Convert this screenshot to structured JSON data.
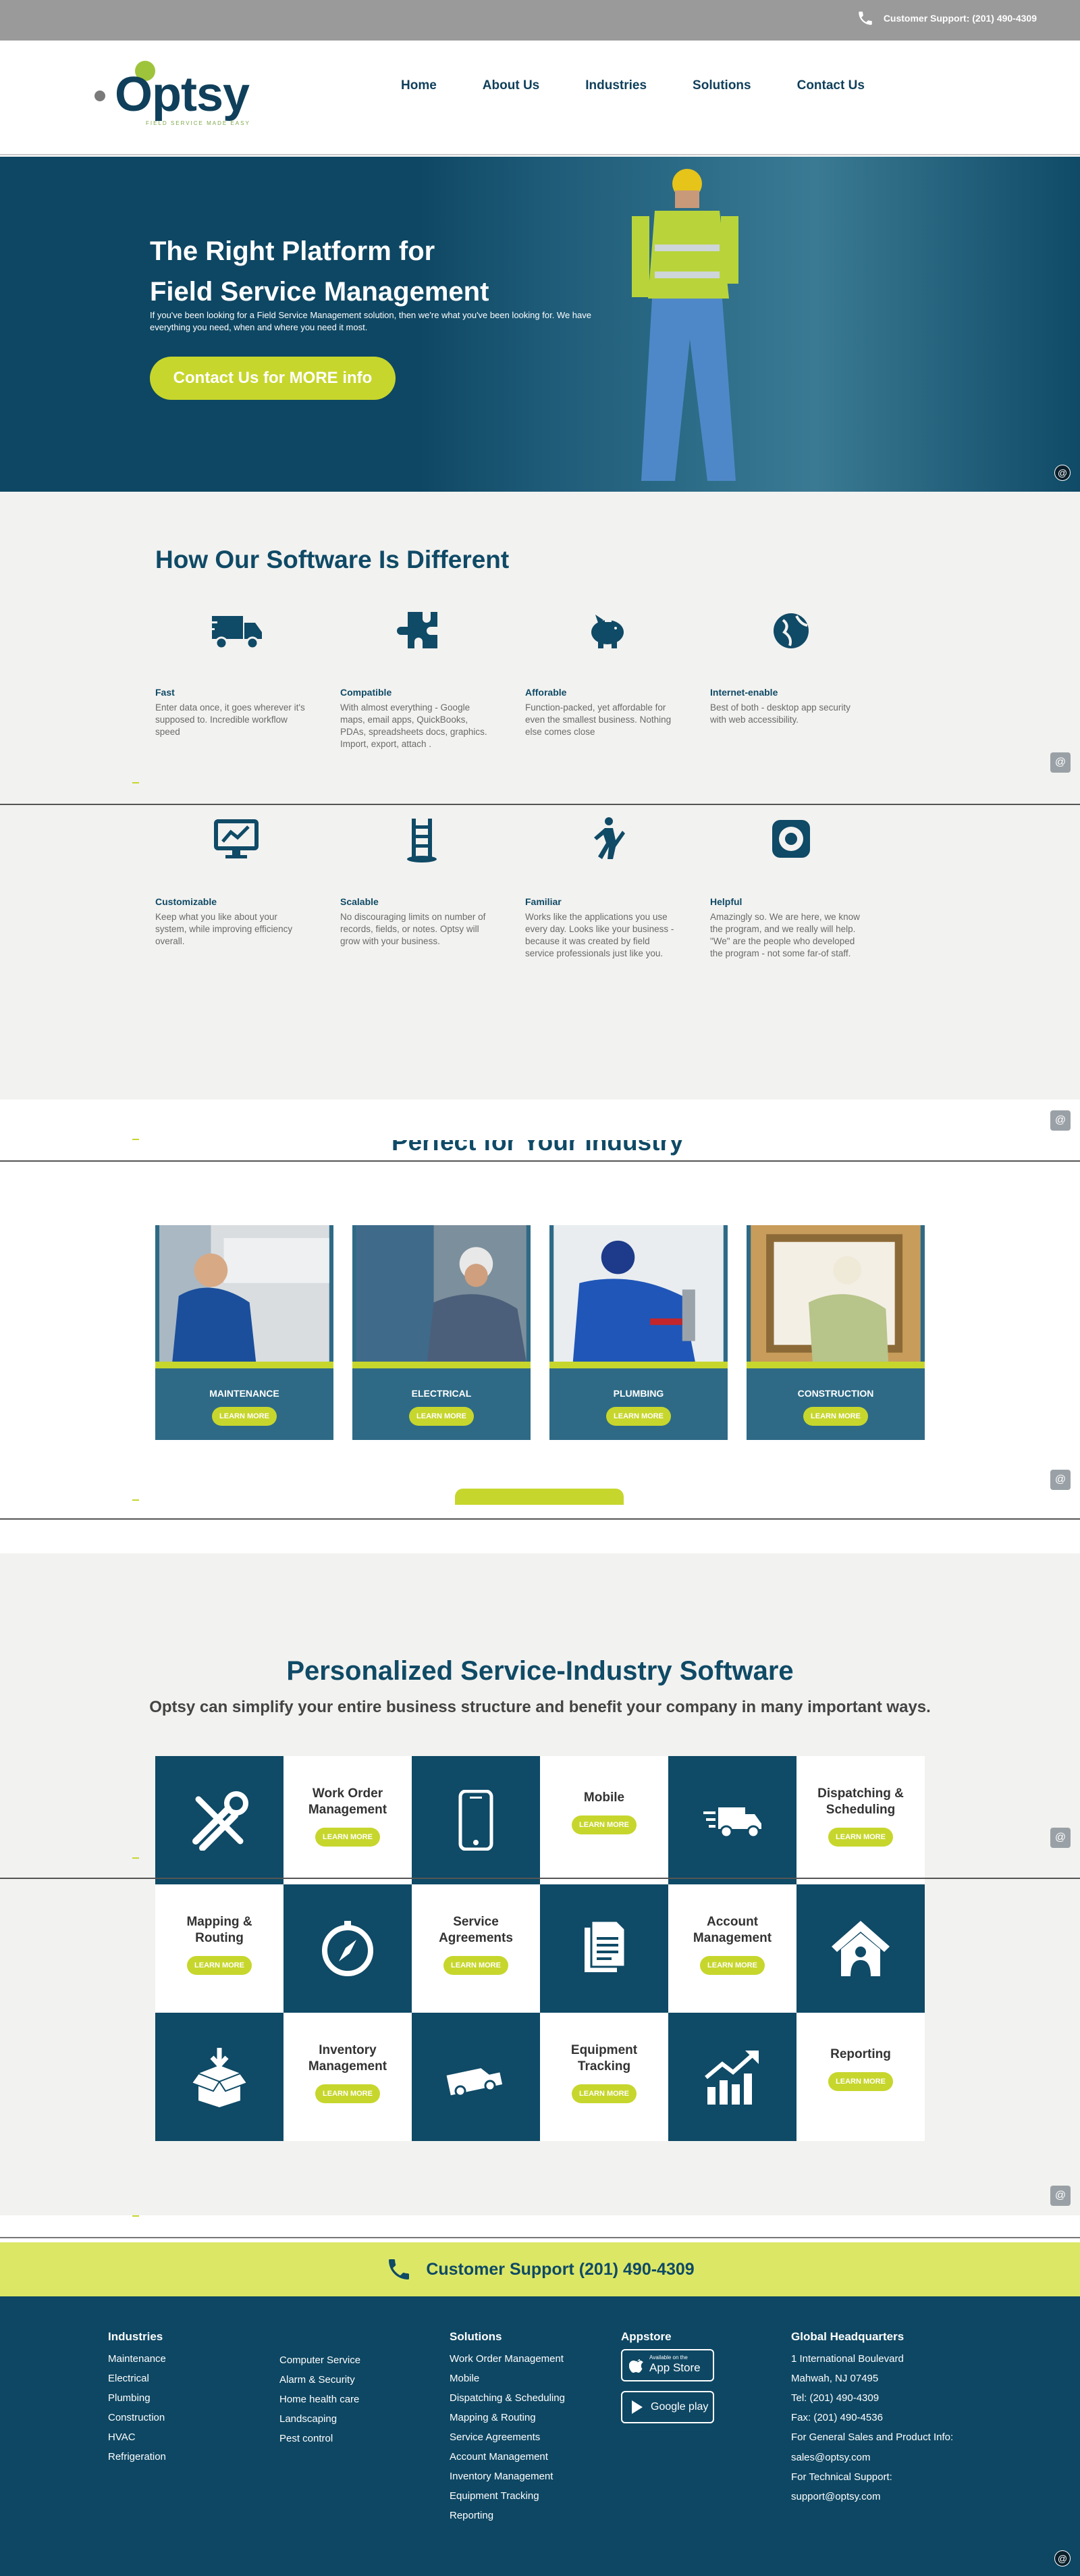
{
  "topbar": {
    "support": "Customer Support: (201) 490-4309",
    "icon": "phone-icon"
  },
  "logo": {
    "word": "Optsy",
    "tagline": "FIELD SERVICE MADE EASY"
  },
  "nav": [
    {
      "label": "Home"
    },
    {
      "label": "About Us"
    },
    {
      "label": "Industries"
    },
    {
      "label": "Solutions"
    },
    {
      "label": "Contact Us"
    }
  ],
  "hero": {
    "title_line1": "The Right Platform for",
    "title_line2": "Field Service Management",
    "text": "If you've been looking for a Field Service Management solution, then we're what you've been looking for. We have everything you need, when and where you need it most.",
    "cta": "Contact Us for MORE info",
    "widget": "@"
  },
  "diff": {
    "heading": "How Our Software Is Different",
    "features": [
      {
        "icon": "truck-icon",
        "title": "Fast",
        "text": "Enter data once, it goes wherever it's supposed to. Incredible workflow speed"
      },
      {
        "icon": "puzzle-icon",
        "title": "Compatible",
        "text": "With almost everything - Google maps, email apps, QuickBooks, PDAs, spreadsheets docs, graphics. Import, export, attach ."
      },
      {
        "icon": "piggy-bank-icon",
        "title": "Afforable",
        "text": "Function-packed, yet affordable for even the smallest business. Nothing else comes close"
      },
      {
        "icon": "globe-icon",
        "title": "Internet-enable",
        "text": "Best of both - desktop app security with web accessibility."
      },
      {
        "icon": "monitor-icon",
        "title": "Customizable",
        "text": "Keep what you like about your system, while improving efficiency overall."
      },
      {
        "icon": "ladder-icon",
        "title": "Scalable",
        "text": "No discouraging limits on number of records, fields, or notes. Optsy will grow with your business."
      },
      {
        "icon": "person-icon",
        "title": "Familiar",
        "text": "Works like the applications you use every day. Looks like your business - because it was created by field service professionals just like you."
      },
      {
        "icon": "lifebuoy-icon",
        "title": "Helpful",
        "text": "Amazingly so. We are here, we know the program, and we really will help. \"We\" are the people who developed the program - not some far-of staff."
      }
    ]
  },
  "industry": {
    "heading": "Perfect for Your Industry",
    "cards": [
      {
        "label": "MAINTENANCE",
        "button": "LEARN MORE"
      },
      {
        "label": "ELECTRICAL",
        "button": "LEARN MORE"
      },
      {
        "label": "PLUMBING",
        "button": "LEARN MORE"
      },
      {
        "label": "CONSTRUCTION",
        "button": "LEARN MORE"
      }
    ]
  },
  "personalized": {
    "heading": "Personalized Service-Industry Software",
    "subheading": "Optsy can simplify your entire business structure and benefit your company in many important ways.",
    "items": [
      {
        "label": "Work Order Management",
        "icon": "wrench-screwdriver-icon",
        "button": "LEARN MORE"
      },
      {
        "label": "Mobile",
        "icon": "smartphone-icon",
        "button": "LEARN MORE"
      },
      {
        "label": "Dispatching & Scheduling",
        "icon": "delivery-truck-icon",
        "button": "LEARN MORE"
      },
      {
        "label": "Mapping & Routing",
        "icon": "compass-icon",
        "button": "LEARN MORE"
      },
      {
        "label": "Service Agreements",
        "icon": "document-icon",
        "button": "LEARN MORE"
      },
      {
        "label": "Account Management",
        "icon": "house-user-icon",
        "button": "LEARN MORE"
      },
      {
        "label": "Inventory Management",
        "icon": "box-icon",
        "button": "LEARN MORE"
      },
      {
        "label": "Equipment Tracking",
        "icon": "van-icon",
        "button": "LEARN MORE"
      },
      {
        "label": "Reporting",
        "icon": "chart-up-icon",
        "button": "LEARN MORE"
      }
    ]
  },
  "support_band": {
    "text": "Customer Support (201) 490-4309"
  },
  "footer": {
    "industries_title": "Industries",
    "industries": [
      "Maintenance",
      "Electrical",
      "Plumbing",
      "Construction",
      "HVAC",
      "Refrigeration"
    ],
    "industries2": [
      "Computer Service",
      "Alarm & Security",
      "Home health care",
      "Landscaping",
      "Pest control"
    ],
    "solutions_title": "Solutions",
    "solutions": [
      "Work Order Management",
      "Mobile",
      "Dispatching & Scheduling",
      "Mapping & Routing",
      "Service Agreements",
      "Account Management",
      "Inventory Management",
      "Equipment Tracking",
      "Reporting"
    ],
    "appstore_title": "Appstore",
    "appstore_small": "Available on the",
    "appstore_big": "App Store",
    "googleplay": "Google play",
    "hq_title": "Global Headquarters",
    "hq": [
      "1 International Boulevard",
      "Mahwah, NJ 07495",
      "Tel: (201) 490-4309",
      "Fax: (201) 490-4536",
      "For General Sales and Product Info:",
      "sales@optsy.com",
      "For Technical Support:",
      "support@optsy.com"
    ]
  },
  "colors": {
    "navy": "#0e4763",
    "lime": "#c7d62c",
    "band": "#dce865",
    "grey": "#f2f2f0"
  }
}
